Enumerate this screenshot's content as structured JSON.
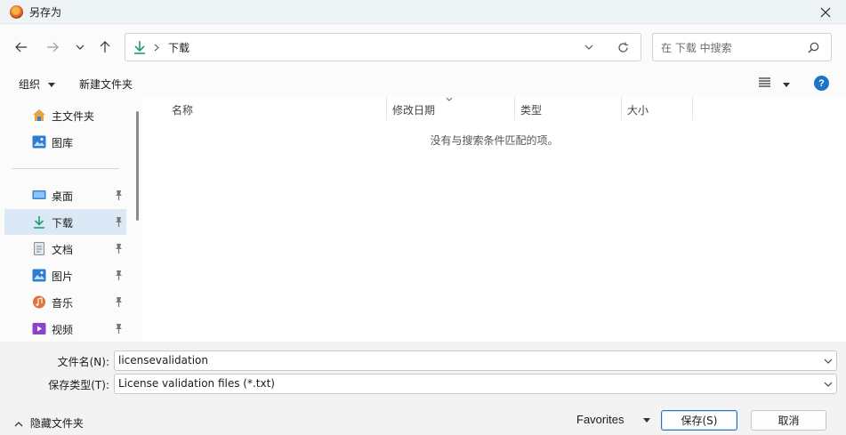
{
  "window": {
    "title": "另存为"
  },
  "nav": {
    "breadcrumb_current": "下载",
    "search_placeholder": "在 下载 中搜索"
  },
  "commands": {
    "organize": "组织",
    "new_folder": "新建文件夹"
  },
  "sidebar": {
    "top_items": [
      {
        "label": "主文件夹",
        "icon": "home-icon"
      },
      {
        "label": "图库",
        "icon": "gallery-icon"
      }
    ],
    "pinned_items": [
      {
        "label": "桌面",
        "icon": "desktop-icon"
      },
      {
        "label": "下载",
        "icon": "download-icon",
        "selected": true
      },
      {
        "label": "文档",
        "icon": "document-icon"
      },
      {
        "label": "图片",
        "icon": "pictures-icon"
      },
      {
        "label": "音乐",
        "icon": "music-icon"
      },
      {
        "label": "视频",
        "icon": "video-icon"
      }
    ]
  },
  "filelist": {
    "columns": [
      "名称",
      "修改日期",
      "类型",
      "大小"
    ],
    "empty_message": "没有与搜索条件匹配的项。"
  },
  "form": {
    "filename_label": "文件名(N):",
    "filename_value": "licensevalidation",
    "filetype_label": "保存类型(T):",
    "filetype_value": "License validation files (*.txt)"
  },
  "footer": {
    "hide_folders": "隐藏文件夹",
    "favorites": "Favorites",
    "save": "保存(S)",
    "cancel": "取消"
  },
  "colors": {
    "accent": "#0067c0",
    "selected_bg": "#dbe8f5",
    "download_green": "#1f9e6e"
  }
}
